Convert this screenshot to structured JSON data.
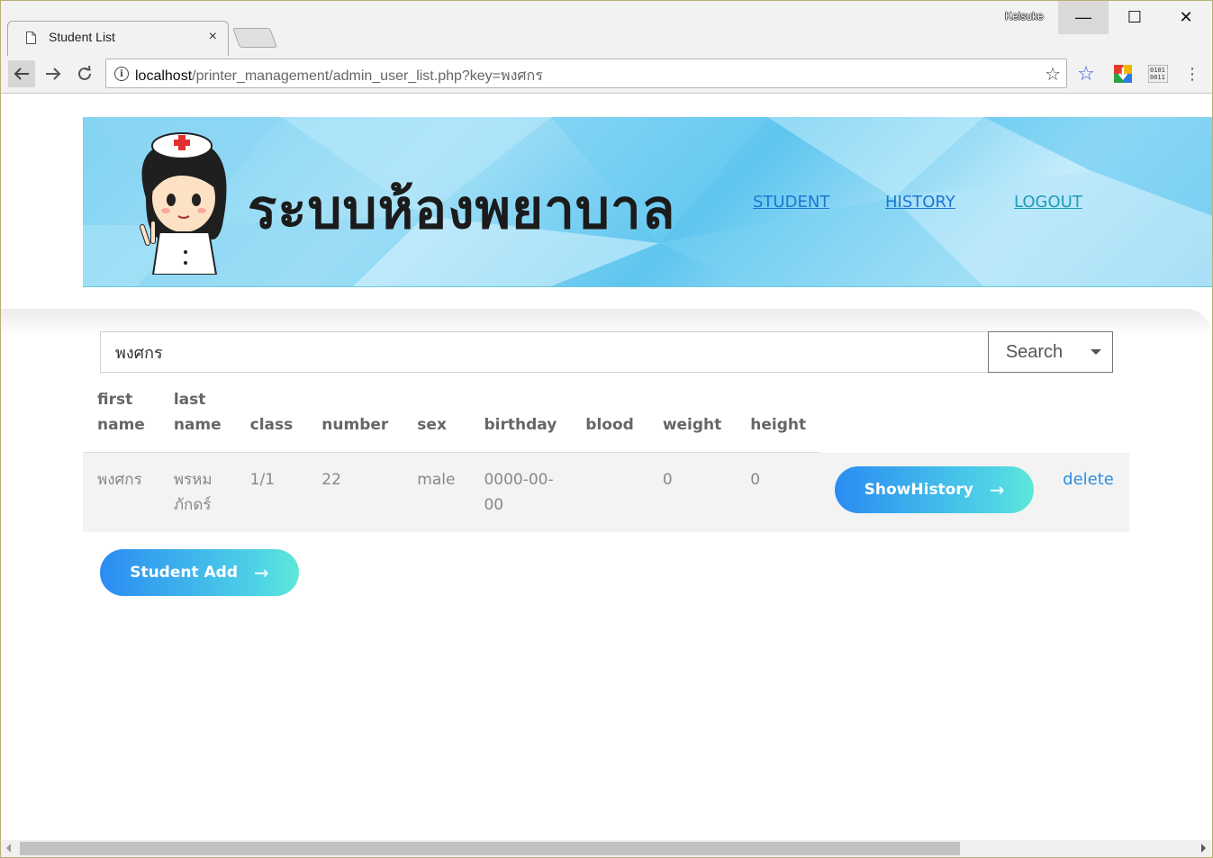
{
  "browser": {
    "tab_title": "Student List",
    "tab_close": "×",
    "profile_name": "Keisuke",
    "url_host": "localhost",
    "url_path": "/printer_management/admin_user_list.php?key=พงศกร",
    "window_min": "—",
    "window_max": "☐",
    "window_close": "✕"
  },
  "header": {
    "site_title": "ระบบห้องพยาบาล",
    "nav": {
      "student": "STUDENT",
      "history": "HISTORY",
      "logout": "LOGOUT"
    }
  },
  "search": {
    "value": "พงศกร",
    "button_label": "Search"
  },
  "table": {
    "columns": {
      "first_name_1": "first",
      "first_name_2": "name",
      "last_name_1": "last",
      "last_name_2": "name",
      "class": "class",
      "number": "number",
      "sex": "sex",
      "birthday": "birthday",
      "blood": "blood",
      "weight": "weight",
      "height": "height"
    },
    "rows": [
      {
        "first_name": "พงศกร",
        "last_name_1": "พรหม",
        "last_name_2": "ภักดร์",
        "class": "1/1",
        "number": "22",
        "sex": "male",
        "birthday_1": "0000-00-",
        "birthday_2": "00",
        "blood": "",
        "weight": "0",
        "height": "0",
        "action_label": "ShowHistory",
        "delete_label": "delete"
      }
    ]
  },
  "actions": {
    "student_add": "Student Add",
    "arrow": "→"
  },
  "colors": {
    "link_blue": "#1b78d0",
    "gradient_start": "#2a8cf2",
    "gradient_end": "#5ee8d8"
  }
}
